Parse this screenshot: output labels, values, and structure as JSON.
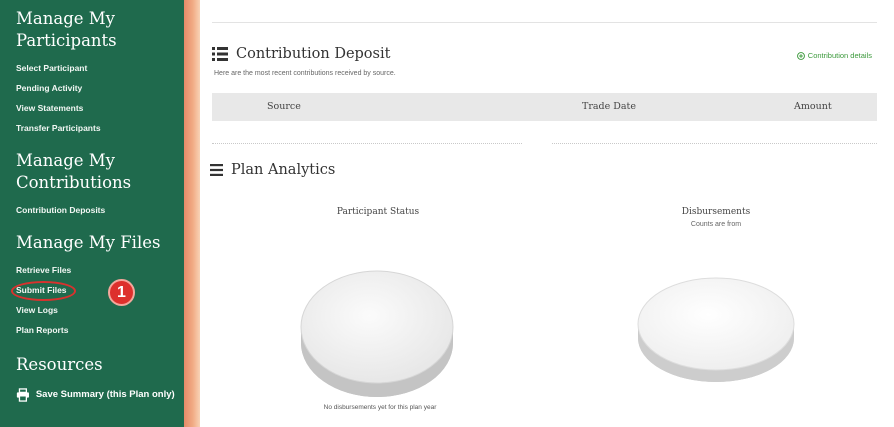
{
  "sidebar": {
    "sections": [
      {
        "title": "Manage My Participants",
        "items": [
          "Select Participant",
          "Pending Activity",
          "View Statements",
          "Transfer Participants"
        ]
      },
      {
        "title": "Manage My Contributions",
        "items": [
          "Contribution Deposits"
        ]
      },
      {
        "title": "Manage My Files",
        "items": [
          "Retrieve Files",
          "Submit Files",
          "View Logs",
          "Plan Reports"
        ]
      }
    ],
    "step_marker": "1",
    "resources_title": "Resources",
    "save_summary_label": "Save Summary (this Plan only)"
  },
  "contribution_deposit": {
    "title": "Contribution Deposit",
    "details_link": "Contribution details",
    "subtitle": "Here are the most recent contributions received by source.",
    "columns": [
      "Source",
      "Trade Date",
      "Amount"
    ]
  },
  "plan_analytics": {
    "title": "Plan Analytics",
    "participant_status_label": "Participant Status",
    "disbursements_label": "Disbursements",
    "disbursements_sub": "Counts are from",
    "no_disbursements_note": "No disbursements yet for this plan year"
  },
  "colors": {
    "sidebar_bg": "#1f6a4d",
    "accent_strip": "#f1ab84",
    "highlight_red": "#dd302c",
    "link_green": "#3c9a3c"
  },
  "icons": {
    "contribution_title_icon": "list-icon",
    "analytics_title_icon": "menu-icon",
    "save_summary_icon": "print-icon",
    "details_link_icon": "plus-circle-icon"
  }
}
